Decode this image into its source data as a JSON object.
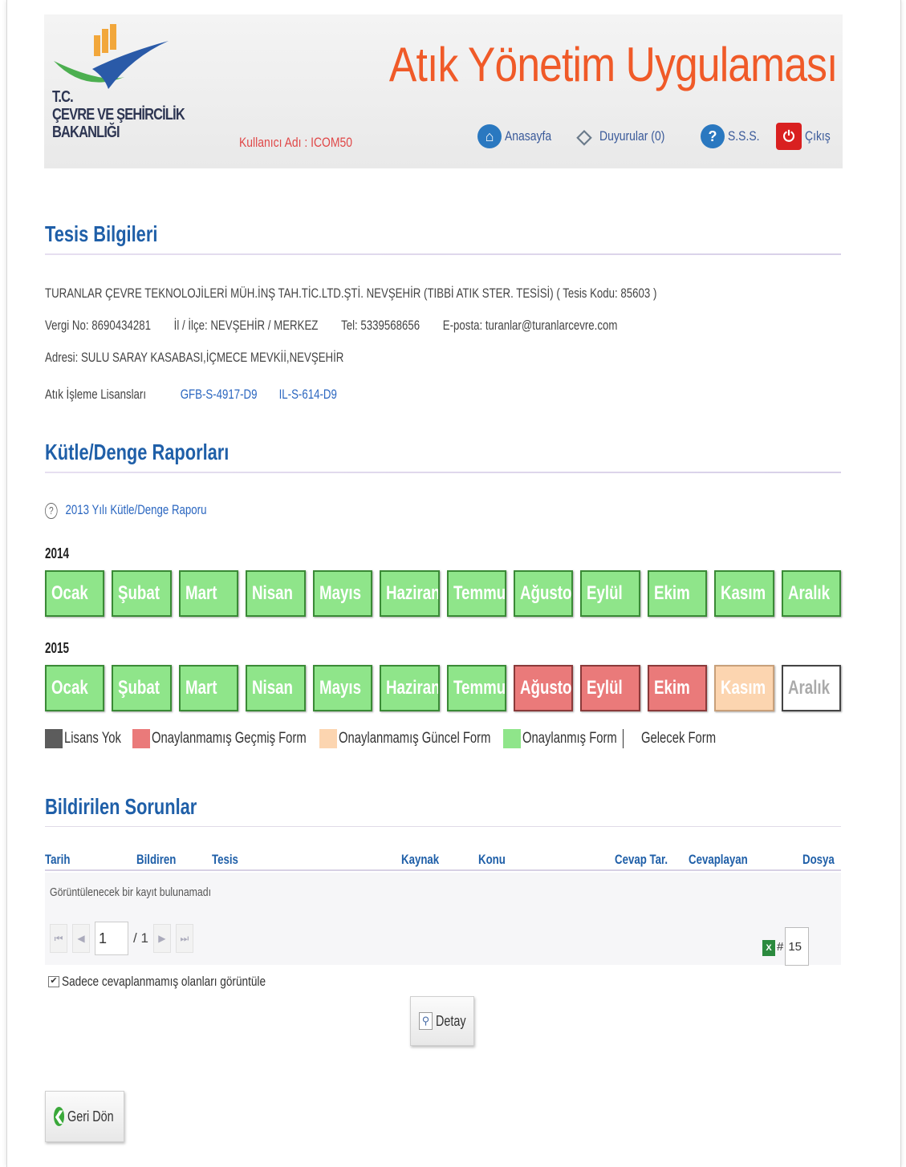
{
  "header": {
    "ministry_lines": [
      "T.C.",
      "ÇEVRE VE ŞEHİRCİLİK",
      "BAKANLIĞI"
    ],
    "app_title": "Atık Yönetim Uygulaması",
    "user_label": "Kullanıcı Adı : ICOM50",
    "nav": {
      "home": "Anasayfa",
      "announcements": "Duyurular (0)",
      "faq": "S.S.S.",
      "logout": "Çıkış"
    }
  },
  "facility": {
    "section_title": "Tesis Bilgileri",
    "name_line": "TURANLAR ÇEVRE TEKNOLOJİLERİ MÜH.İNŞ TAH.TİC.LTD.ŞTİ. NEVŞEHİR (TIBBİ ATIK STER. TESİSİ)     ( Tesis Kodu: 85603 )",
    "tax_no": "Vergi No: 8690434281",
    "province": "İl / İlçe: NEVŞEHİR / MERKEZ",
    "phone": "Tel: 5339568656",
    "email": "E-posta: turanlar@turanlarcevre.com",
    "address": "Adresi:   SULU SARAY KASABASI,İÇMECE MEVKİİ,NEVŞEHİR",
    "license_label": "Atık İşleme Lisansları",
    "licenses": [
      "GFB-S-4917-D9",
      "IL-S-614-D9"
    ]
  },
  "reports": {
    "section_title": "Kütle/Denge Raporları",
    "report_link": "2013 Yılı Kütle/Denge Raporu",
    "year_2014": "2014",
    "year_2015": "2015",
    "months": [
      "Ocak",
      "Şubat",
      "Mart",
      "Nisan",
      "Mayıs",
      "Haziran",
      "Temmuz",
      "Ağustos",
      "Eylül",
      "Ekim",
      "Kasım",
      "Aralık"
    ],
    "status_2014": [
      "approved",
      "approved",
      "approved",
      "approved",
      "approved",
      "approved",
      "approved",
      "approved",
      "approved",
      "approved",
      "approved",
      "approved"
    ],
    "status_2015": [
      "approved",
      "approved",
      "approved",
      "approved",
      "approved",
      "approved",
      "approved",
      "past",
      "past",
      "past",
      "current",
      "future"
    ],
    "legend": {
      "no_license": "Lisans Yok",
      "unapproved_past": "Onaylanmamış Geçmiş Form",
      "unapproved_current": "Onaylanmamış Güncel Form",
      "approved": "Onaylanmış Form",
      "future": "Gelecek Form"
    },
    "colors": {
      "no_license": "#5c5c5c",
      "past": "#ea7a7a",
      "current": "#fcd5b0",
      "approved": "#8fe58a",
      "future": "#ffffff"
    }
  },
  "issues": {
    "section_title": "Bildirilen Sorunlar",
    "columns": [
      "Tarih",
      "Bildiren",
      "Tesis",
      "Kaynak",
      "Konu",
      "Cevap Tar.",
      "Cevaplayan",
      "Dosya"
    ],
    "empty_message": "Görüntülenecek bir kayıt bulunamadı",
    "pager": {
      "page": "1",
      "total": "/ 1",
      "per_page_prefix": "#",
      "per_page": "15"
    },
    "checkbox_label": "Sadece cevaplanmamış olanları görüntüle",
    "detail_button": "Detay"
  },
  "back_button": "Geri Dön"
}
